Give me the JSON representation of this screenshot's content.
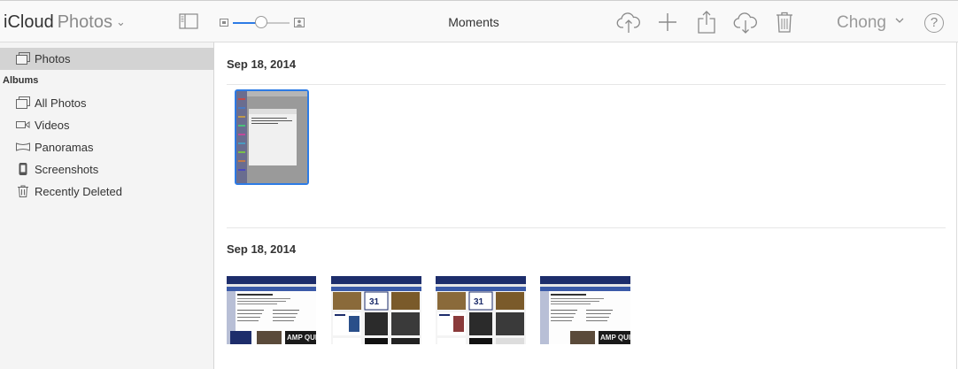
{
  "header": {
    "app_name": "iCloud",
    "app_section": "Photos",
    "view_title": "Moments",
    "user_name": "Chong",
    "help_label": "?",
    "zoom_level": 0.5,
    "toolbar_icons": [
      "upload-icon",
      "add-icon",
      "share-icon",
      "download-icon",
      "trash-icon"
    ]
  },
  "sidebar": {
    "top_item": "Photos",
    "albums_heading": "Albums",
    "albums": [
      {
        "label": "All Photos",
        "icon": "all-photos-icon"
      },
      {
        "label": "Videos",
        "icon": "video-icon"
      },
      {
        "label": "Panoramas",
        "icon": "panorama-icon"
      },
      {
        "label": "Screenshots",
        "icon": "screenshot-icon"
      },
      {
        "label": "Recently Deleted",
        "icon": "trash-icon"
      }
    ]
  },
  "moments": [
    {
      "date": "Sep 18, 2014",
      "photo_count": 1,
      "selected_index": 0
    },
    {
      "date": "Sep 18, 2014",
      "photo_count": 4,
      "thumbnail_text": [
        "31",
        "AMP QUIZ"
      ]
    }
  ],
  "colors": {
    "accent": "#2d7be5",
    "sidebar_bg": "#f4f4f4",
    "selected_row": "#d3d3d3",
    "toolbar_bg": "#f9f9f9"
  }
}
